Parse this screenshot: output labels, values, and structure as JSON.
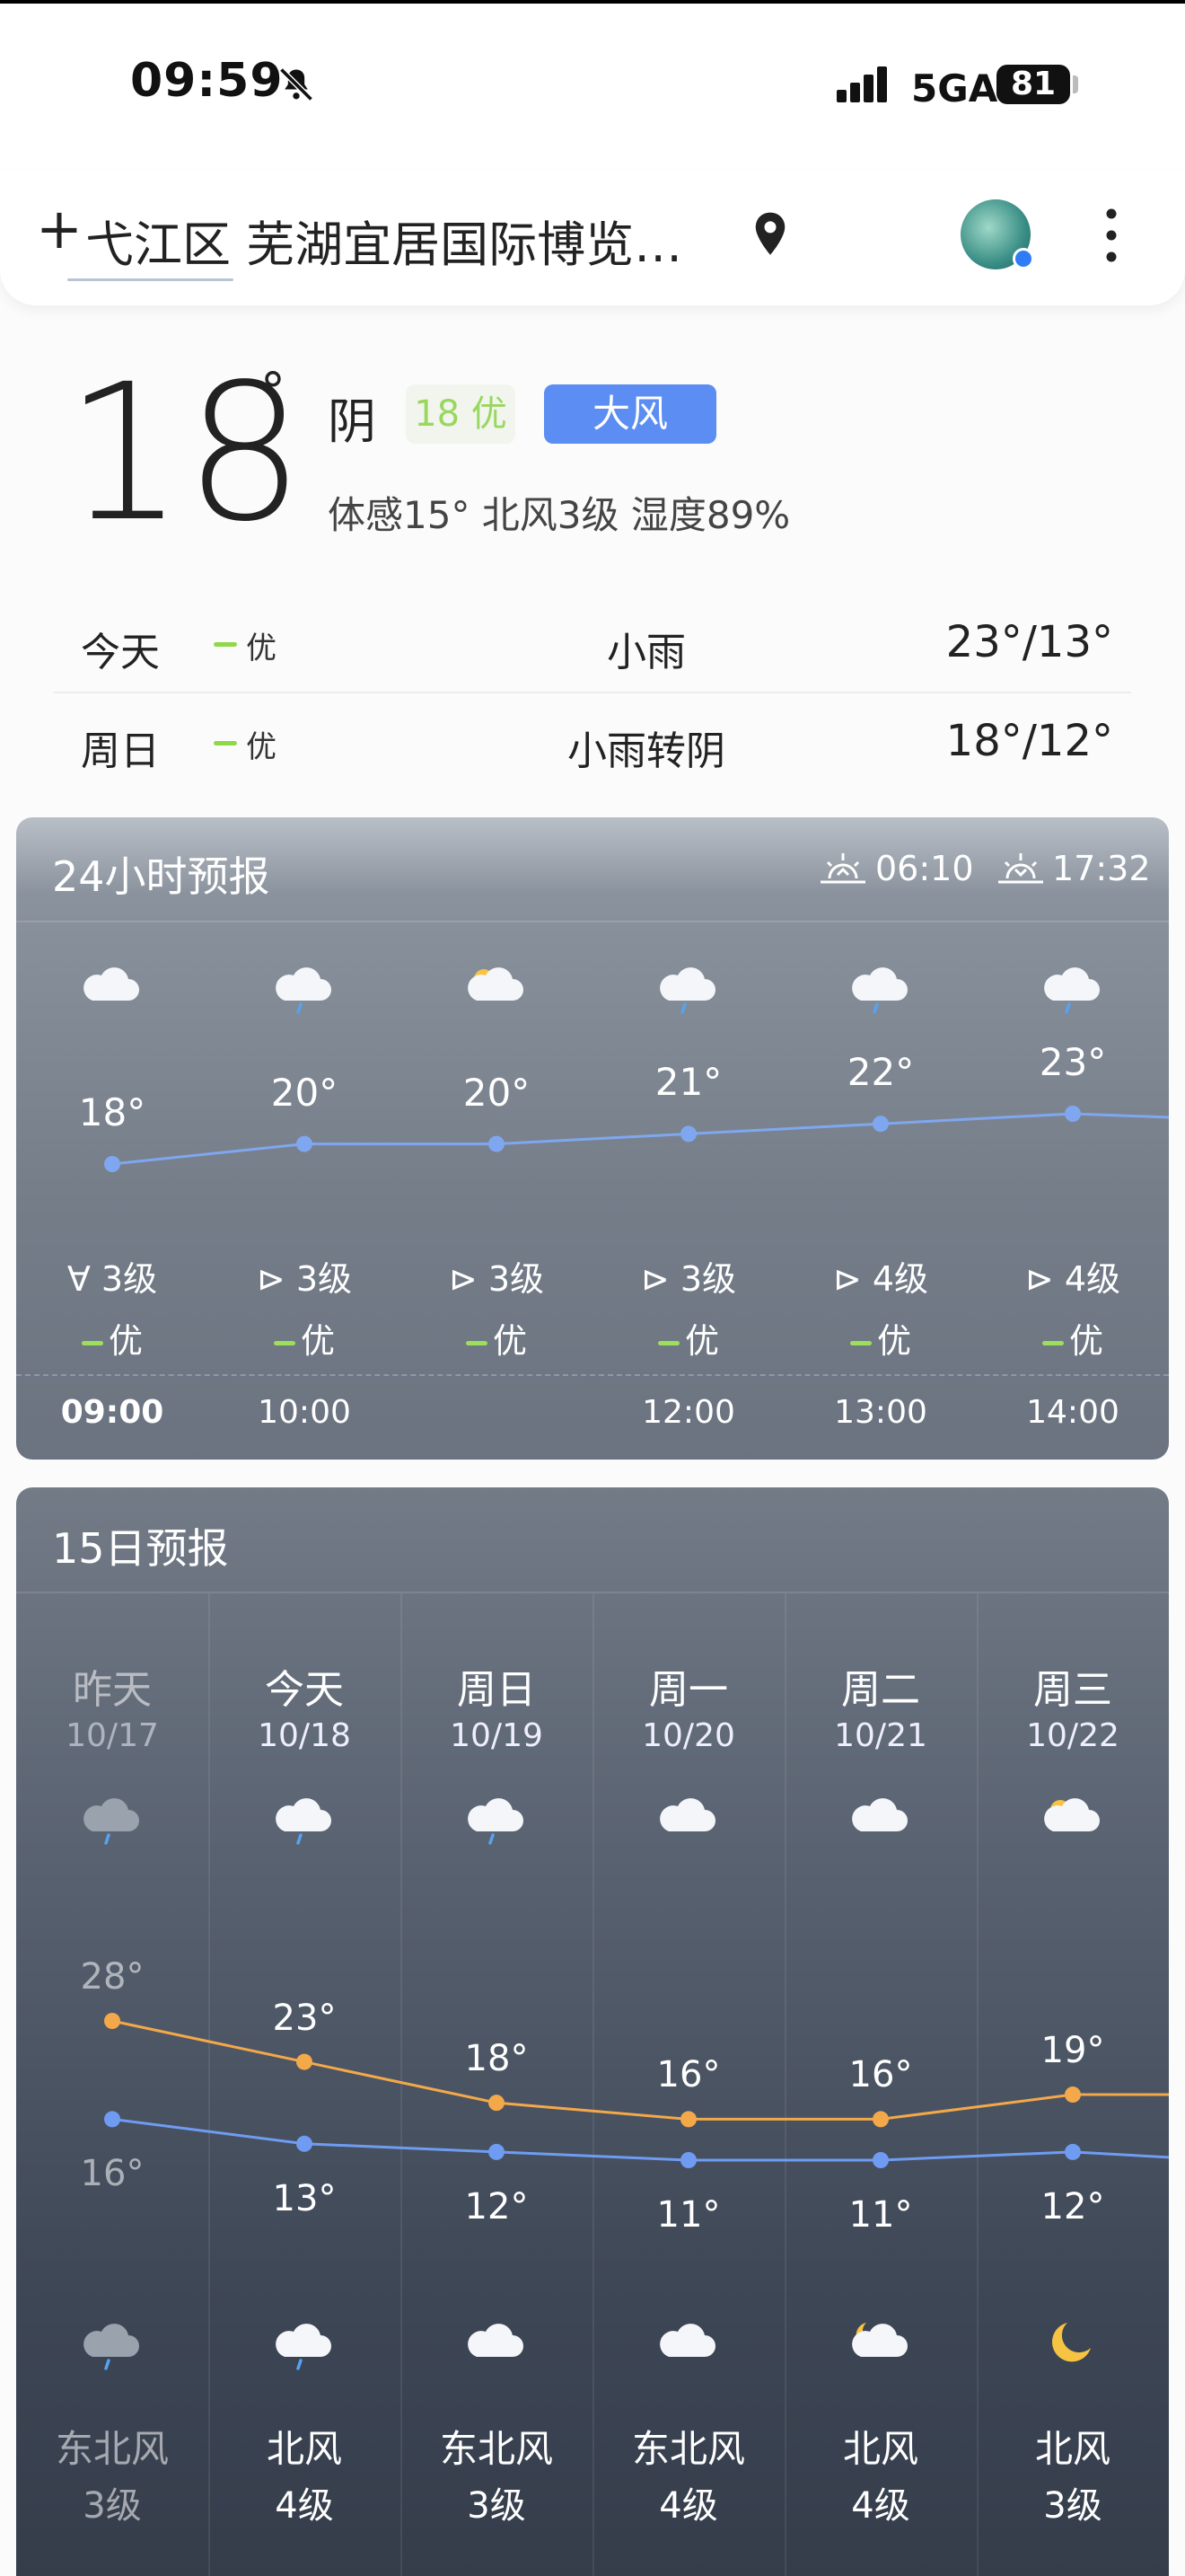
{
  "status_bar": {
    "time": "09:59",
    "network": "5GA",
    "battery": "81",
    "bell_icon": "bell-muted-icon",
    "signal_icon": "signal-bars-icon"
  },
  "header": {
    "add_label": "+",
    "location": "弋江区 芜湖宜居国际博览…",
    "pin_icon": "location-pin-icon",
    "more_icon": "more-vertical-icon"
  },
  "current": {
    "temp": "18",
    "degree": "°",
    "condition": "阴",
    "aqi": "18 优",
    "alert": "大风",
    "detail": "体感15° 北风3级 湿度89%",
    "colors": {
      "aqi_good": "#9ad75e",
      "alert_bg": "#5b8df3"
    }
  },
  "summary": [
    {
      "day": "今天",
      "aqi": "优",
      "condition": "小雨",
      "temps": "23°/13°"
    },
    {
      "day": "周日",
      "aqi": "优",
      "condition": "小雨转阴",
      "temps": "18°/12°"
    }
  ],
  "hourly": {
    "title": "24小时预报",
    "sunrise": "06:10",
    "sunset": "17:32",
    "items": [
      {
        "icon": "cloudy-icon",
        "temp": "18°",
        "temp_value": 18,
        "wind": "∀ 3级",
        "aqi": "优",
        "time": "09:00"
      },
      {
        "icon": "rain-icon",
        "temp": "20°",
        "temp_value": 20,
        "wind": "⊳ 3级",
        "aqi": "优",
        "time": "10:00"
      },
      {
        "icon": "partly-sunny-icon",
        "temp": "20°",
        "temp_value": 20,
        "wind": "⊳ 3级",
        "aqi": "优",
        "time": ""
      },
      {
        "icon": "rain-icon",
        "temp": "21°",
        "temp_value": 21,
        "wind": "⊳ 3级",
        "aqi": "优",
        "time": "12:00"
      },
      {
        "icon": "rain-icon",
        "temp": "22°",
        "temp_value": 22,
        "wind": "⊳ 4级",
        "aqi": "优",
        "time": "13:00"
      },
      {
        "icon": "rain-icon",
        "temp": "23°",
        "temp_value": 23,
        "wind": "⊳ 4级",
        "aqi": "优",
        "time": "14:00"
      }
    ]
  },
  "daily": {
    "title": "15日预报",
    "items": [
      {
        "day": "昨天",
        "date": "10/17",
        "icon": "rain-icon",
        "high": "28°",
        "high_value": 28,
        "low": "16°",
        "low_value": 16,
        "night_icon": "rain-icon",
        "wind_dir": "东北风",
        "wind_level": "3级",
        "past": true
      },
      {
        "day": "今天",
        "date": "10/18",
        "icon": "rain-icon",
        "high": "23°",
        "high_value": 23,
        "low": "13°",
        "low_value": 13,
        "night_icon": "rain-icon",
        "wind_dir": "北风",
        "wind_level": "4级",
        "past": false
      },
      {
        "day": "周日",
        "date": "10/19",
        "icon": "rain-icon",
        "high": "18°",
        "high_value": 18,
        "low": "12°",
        "low_value": 12,
        "night_icon": "cloudy-icon",
        "wind_dir": "东北风",
        "wind_level": "3级",
        "past": false
      },
      {
        "day": "周一",
        "date": "10/20",
        "icon": "cloudy-icon",
        "high": "16°",
        "high_value": 16,
        "low": "11°",
        "low_value": 11,
        "night_icon": "cloudy-icon",
        "wind_dir": "东北风",
        "wind_level": "4级",
        "past": false
      },
      {
        "day": "周二",
        "date": "10/21",
        "icon": "cloudy-icon",
        "high": "16°",
        "high_value": 16,
        "low": "11°",
        "low_value": 11,
        "night_icon": "moon-cloudy-icon",
        "wind_dir": "北风",
        "wind_level": "4级",
        "past": false
      },
      {
        "day": "周三",
        "date": "10/22",
        "icon": "partly-sunny-icon",
        "high": "19°",
        "high_value": 19,
        "low": "12°",
        "low_value": 12,
        "night_icon": "moon-icon",
        "wind_dir": "北风",
        "wind_level": "3级",
        "past": false
      }
    ],
    "colors": {
      "high_line": "#f3a84a",
      "low_line": "#6f9cf2"
    }
  },
  "colors": {
    "hourly_line": "#7fa7f0",
    "aqi_bar": "#9be05a"
  }
}
